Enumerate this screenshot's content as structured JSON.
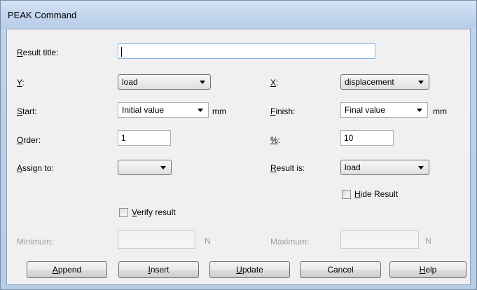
{
  "window": {
    "title": "PEAK Command"
  },
  "fields": {
    "result_title": {
      "label_u": "R",
      "label_rest": "esult title:",
      "value": ""
    },
    "y": {
      "label_u": "Y",
      "label_rest": ":",
      "value": "load"
    },
    "x": {
      "label_u": "X",
      "label_rest": ":",
      "value": "displacement"
    },
    "start": {
      "label_u": "S",
      "label_rest": "tart:",
      "value": "Initial value",
      "unit": "mm"
    },
    "finish": {
      "label_u": "F",
      "label_rest": "inish:",
      "value": "Final value",
      "unit": "mm"
    },
    "order": {
      "label_u": "O",
      "label_rest": "rder:",
      "value": "1"
    },
    "percent": {
      "label_u": "%",
      "label_rest": ":",
      "value": "10"
    },
    "assign_to": {
      "label_u": "A",
      "label_rest": "ssign to:",
      "value": ""
    },
    "result_is": {
      "label_u": "R",
      "label_rest": "esult is:",
      "value": "load"
    },
    "hide_result": {
      "label_u": "H",
      "label_rest": "ide Result",
      "checked": false
    },
    "verify_result": {
      "label_u": "V",
      "label_rest": "erify result",
      "checked": false
    },
    "minimum": {
      "label": "Minimum:",
      "value": "",
      "unit": "N"
    },
    "maximum": {
      "label": "Maximum:",
      "value": "",
      "unit": "N"
    }
  },
  "buttons": {
    "append": {
      "u": "A",
      "rest": "ppend"
    },
    "insert": {
      "u": "I",
      "rest": "nsert"
    },
    "update": {
      "u": "U",
      "rest": "pdate"
    },
    "cancel": {
      "label": "Cancel"
    },
    "help": {
      "u": "H",
      "rest": "elp"
    }
  }
}
